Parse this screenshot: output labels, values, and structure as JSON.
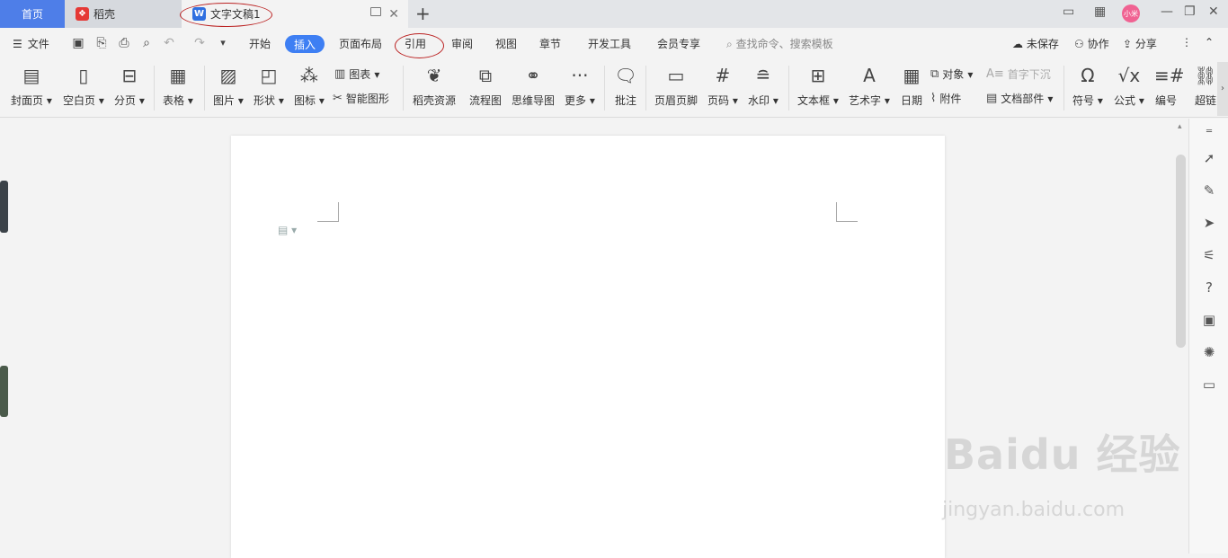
{
  "tabs": {
    "home": "首页",
    "daoke": "稻壳",
    "doc": "文字文稿1"
  },
  "menu": {
    "file": "文件",
    "tabs": [
      "开始",
      "插入",
      "页面布局",
      "引用",
      "审阅",
      "视图",
      "章节",
      "开发工具",
      "会员专享"
    ],
    "search": "查找命令、搜索模板",
    "unsaved": "未保存",
    "collab": "协作",
    "share": "分享"
  },
  "avatar": "小米",
  "ribbon": {
    "cover": "封面页",
    "blank": "空白页",
    "pagebreak": "分页",
    "table": "表格",
    "picture": "图片",
    "shape": "形状",
    "icon": "图标",
    "chart": "图表",
    "smartart": "智能图形",
    "daoke_res": "稻壳资源",
    "flowchart": "流程图",
    "mindmap": "思维导图",
    "more": "更多",
    "comment": "批注",
    "header_footer": "页眉页脚",
    "pagenum": "页码",
    "watermark": "水印",
    "textbox": "文本框",
    "wordart": "艺术字",
    "date": "日期",
    "object": "对象",
    "dropcap": "首字下沉",
    "attachment": "附件",
    "docpart": "文档部件",
    "symbol": "符号",
    "formula": "公式",
    "numbering": "编号",
    "hyperlink": "超链"
  },
  "watermark": {
    "main": "Baidu 经验",
    "sub": "jingyan.baidu.com"
  },
  "colors": {
    "accent": "#3e7ff3",
    "home_tab": "#4e7ee8",
    "annotation": "#b22222"
  }
}
